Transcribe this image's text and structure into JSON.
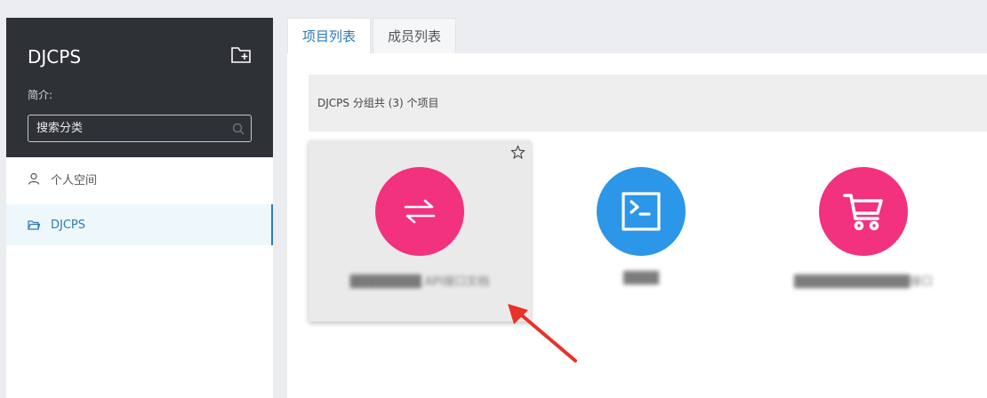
{
  "sidebar": {
    "title": "DJCPS",
    "intro_label": "简介:",
    "search_placeholder": "搜索分类",
    "items": [
      {
        "label": "个人空间",
        "icon": "user-icon",
        "active": false
      },
      {
        "label": "DJCPS",
        "icon": "folder-icon",
        "active": true
      }
    ]
  },
  "tabs": [
    {
      "label": "项目列表",
      "active": true
    },
    {
      "label": "成员列表",
      "active": false
    }
  ],
  "info_text": "DJCPS 分组共 (3) 个项目",
  "projects": [
    {
      "name": "████████ API接口文档",
      "icon": "exchange-arrows-icon",
      "color": "#f2317f"
    },
    {
      "name": "████",
      "icon": "terminal-icon",
      "color": "#2c96e8"
    },
    {
      "name": "█████████████接口",
      "icon": "shopping-cart-icon",
      "color": "#f2317f"
    }
  ]
}
